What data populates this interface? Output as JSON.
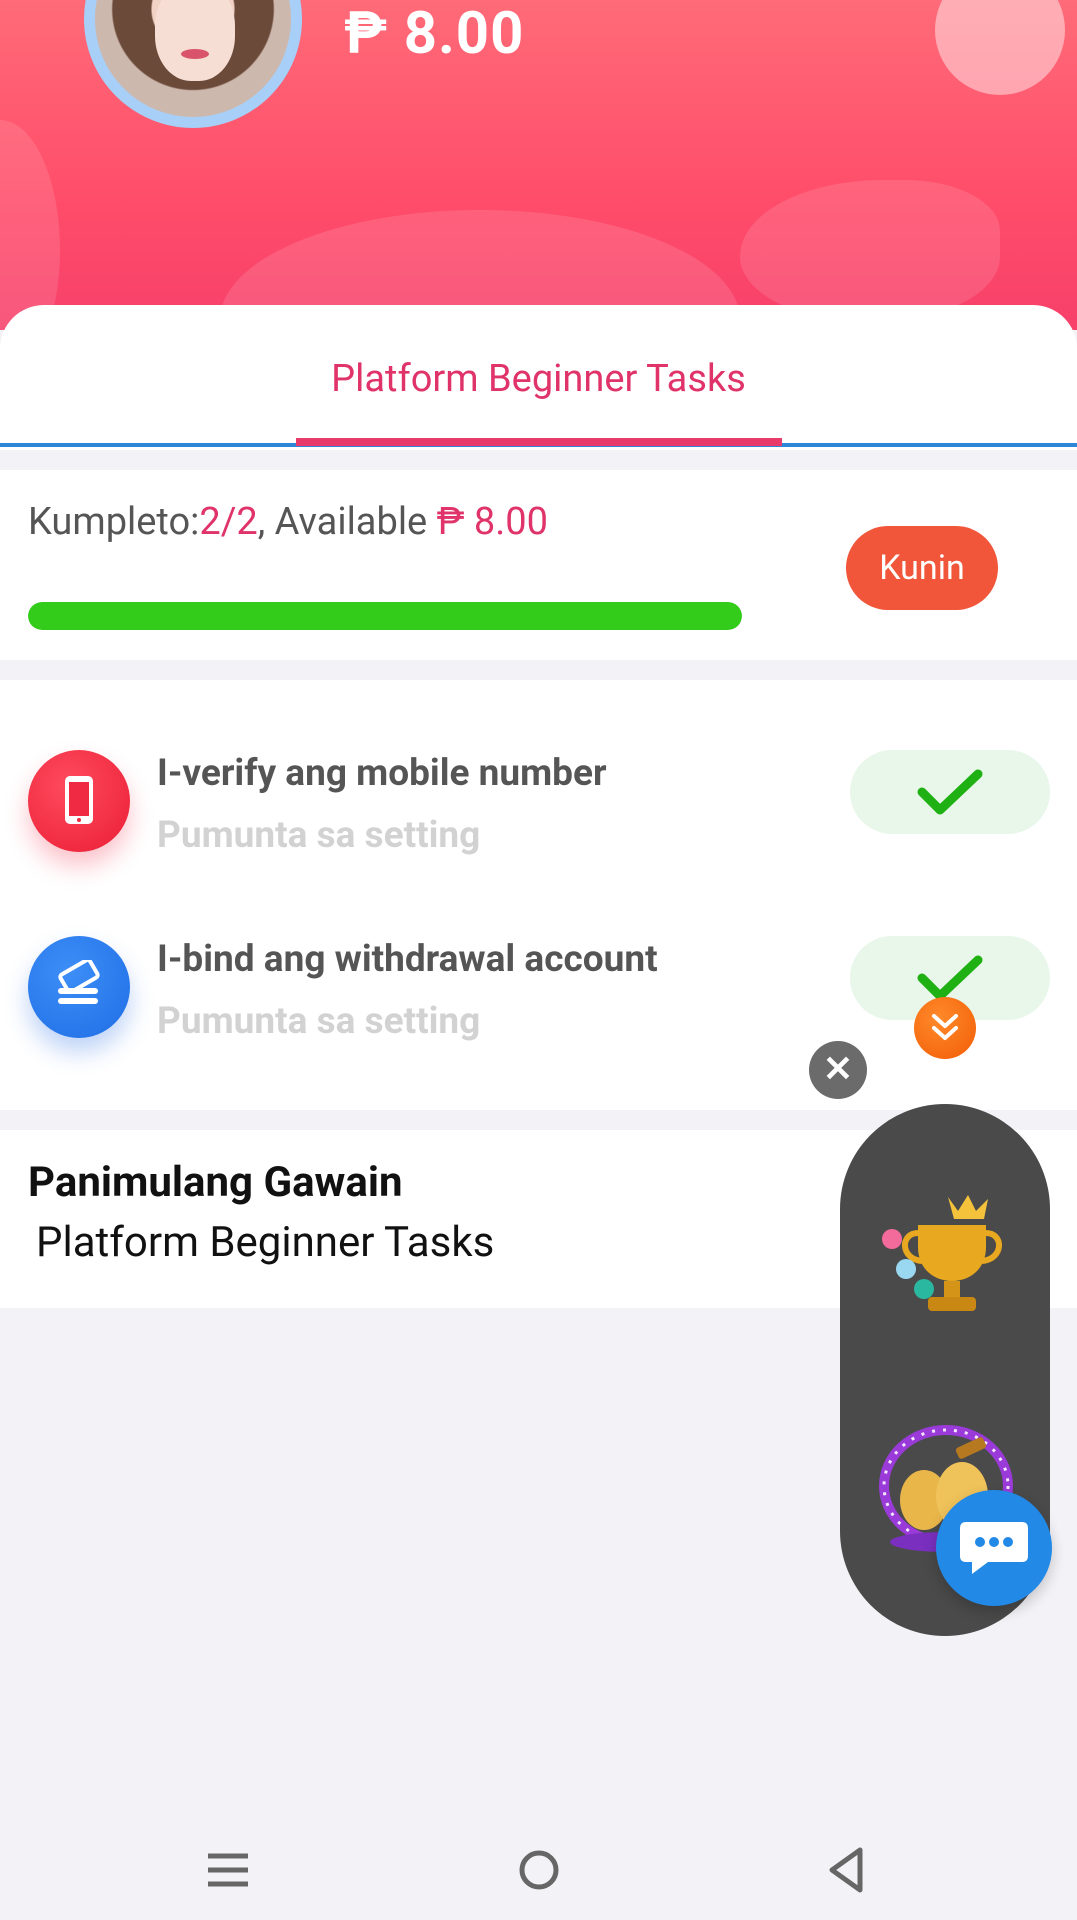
{
  "header": {
    "balance": "₱ 8.00"
  },
  "tabs": {
    "active_label": "Platform Beginner Tasks"
  },
  "progress": {
    "prefix": "Kumpleto:",
    "count": "2/2",
    "mid": ", Available ",
    "amount": "₱ 8.00",
    "fraction": 1.0,
    "claim_label": "Kunin"
  },
  "tasks": [
    {
      "title": "I-verify ang mobile number",
      "subtitle": "Pumunta sa setting",
      "completed": true,
      "icon": "mobile-phone-icon"
    },
    {
      "title": "I-bind ang withdrawal account",
      "subtitle": "Pumunta sa setting",
      "completed": true,
      "icon": "bank-card-icon"
    }
  ],
  "info": {
    "title": "Panimulang Gawain",
    "subtitle": "Platform Beginner Tasks"
  },
  "floating": {
    "close_icon": "close-icon",
    "collapse_icon": "chevrons-down-icon",
    "items": [
      "trophy-icon",
      "golden-eggs-icon"
    ],
    "chat_icon": "chat-bubble-icon"
  },
  "colors": {
    "accent": "#e0336a",
    "header_gradient": "#ff5a70",
    "progress_fill": "#33cc1a",
    "claim_button": "#f2563a",
    "tab_line": "#2e86d8"
  }
}
